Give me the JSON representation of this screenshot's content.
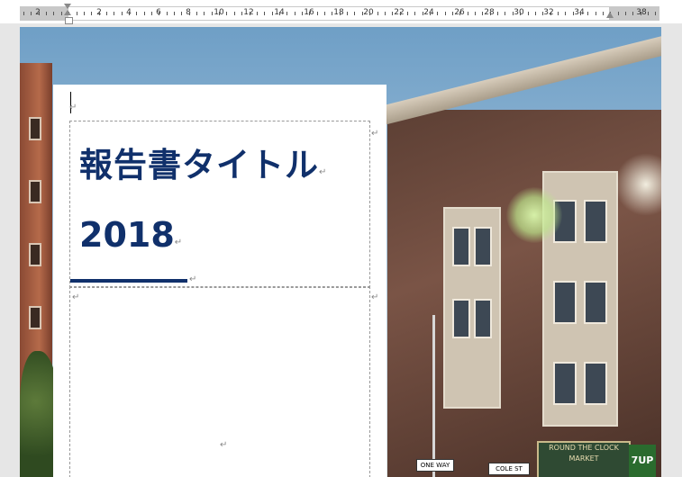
{
  "ruler": {
    "numbers": [
      "2",
      "2",
      "4",
      "6",
      "8",
      "10",
      "12",
      "14",
      "16",
      "18",
      "20",
      "22",
      "24",
      "26",
      "28",
      "30",
      "32",
      "34",
      "38"
    ]
  },
  "document": {
    "title": "報告書タイトル",
    "year": "2018",
    "paragraph_mark": "↵",
    "accent_color": "#10306b"
  },
  "background_photo": {
    "sign_text": "ROUND THE CLOCK MARKET",
    "sign_7up": "7UP",
    "street_sign_1": "ONE WAY",
    "street_sign_2": "COLE ST"
  }
}
